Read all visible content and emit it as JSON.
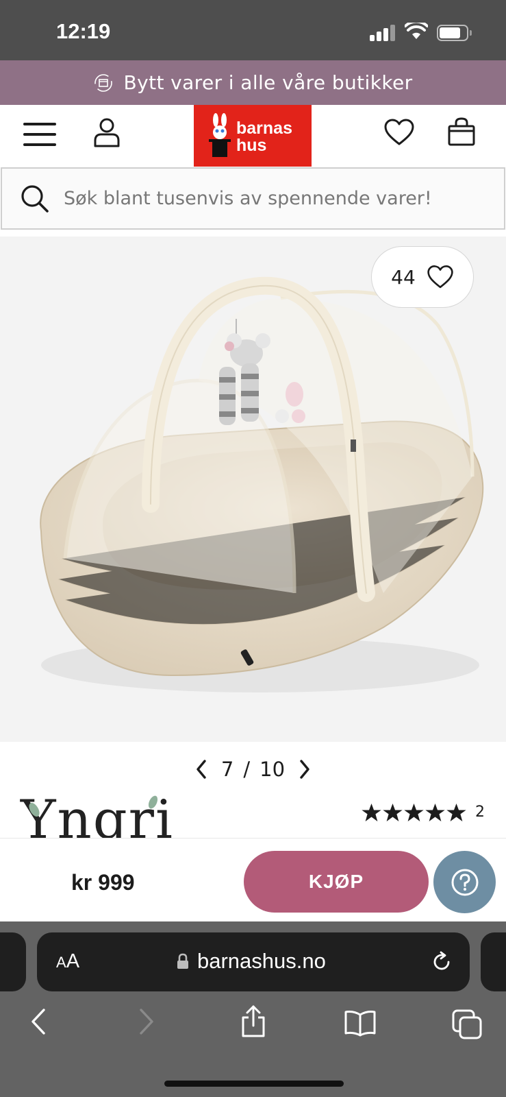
{
  "status_bar": {
    "time": "12:19"
  },
  "promo": {
    "text": "Bytt varer i alle våre butikker",
    "icon": "exchange-box-icon",
    "background": "#8f7186"
  },
  "header": {
    "logo_line1": "barnas",
    "logo_line2": "hus",
    "logo_color": "#e2231a",
    "icons": [
      "menu-icon",
      "account-icon",
      "heart-icon",
      "shopping-bag-icon"
    ]
  },
  "search": {
    "placeholder": "Søk blant tusenvis av spennende varer!"
  },
  "product": {
    "favorites_count": "44",
    "image": "beige baby nest with mosquito net canopy and play arch",
    "pager": {
      "current": "7",
      "separator": "/",
      "total": "10"
    },
    "brand": "Yngri",
    "rating_stars": 5,
    "review_count": "2",
    "price": "kr 999",
    "buy_label": "KJØP",
    "buy_color": "#b35b78",
    "help_color": "#6e8ea3"
  },
  "browser": {
    "aa_small": "A",
    "aa_big": "A",
    "url": "barnashus.no",
    "toolbar_icons": [
      "back-icon",
      "forward-icon",
      "share-icon",
      "bookmarks-icon",
      "tabs-icon"
    ]
  }
}
